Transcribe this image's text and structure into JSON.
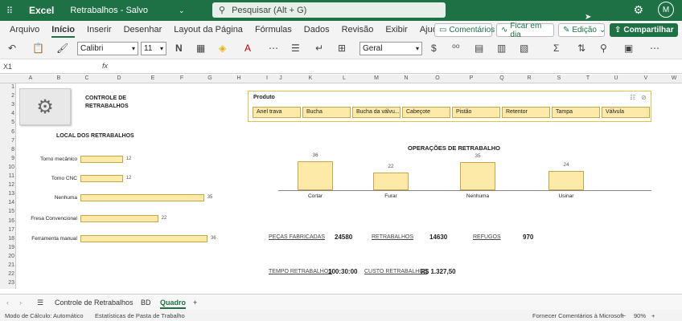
{
  "titlebar": {
    "app": "Excel",
    "doc": "Retrabalhos - Salvo",
    "search_placeholder": "Pesquisar (Alt + G)",
    "avatar": "M"
  },
  "menu": {
    "tabs": [
      "Arquivo",
      "Início",
      "Inserir",
      "Desenhar",
      "Layout da Página",
      "Fórmulas",
      "Dados",
      "Revisão",
      "Exibir",
      "Ajuda"
    ],
    "active": "Início",
    "comments": "Comentários",
    "catchup": "Ficar em dia",
    "editing": "Edição",
    "share": "Compartilhar"
  },
  "ribbon": {
    "font": "Calibri",
    "size": "11",
    "format": "Geral"
  },
  "formula": {
    "cell": "X1",
    "fx": "fx"
  },
  "columns": [
    "A",
    "B",
    "C",
    "D",
    "E",
    "F",
    "G",
    "H",
    "I",
    "J",
    "K",
    "L",
    "M",
    "N",
    "O",
    "P",
    "Q",
    "R",
    "S",
    "T",
    "U",
    "V",
    "W"
  ],
  "rows": [
    "1",
    "2",
    "3",
    "4",
    "5",
    "6",
    "7",
    "8",
    "9",
    "10",
    "11",
    "12",
    "13",
    "14",
    "15",
    "16",
    "17",
    "18",
    "19",
    "20",
    "21",
    "22",
    "23"
  ],
  "dashboard": {
    "control_title_1": "CONTROLE DE",
    "control_title_2": "RETRABALHOS",
    "local_title": "LOCAL DOS RETRABALHOS",
    "local_items": [
      {
        "label": "Torno mecânico",
        "value": 12
      },
      {
        "label": "Torno CNC",
        "value": 12
      },
      {
        "label": "Nenhuma",
        "value": 35
      },
      {
        "label": "Fresa Convencional",
        "value": 22
      },
      {
        "label": "Ferramenta manual",
        "value": 36
      }
    ],
    "slicer_title": "Produto",
    "slicer_items": [
      "Anel trava",
      "Bucha",
      "Bucha da válvu...",
      "Cabeçote",
      "Pistão",
      "Retentor",
      "Tampa",
      "Válvula"
    ],
    "ops_title": "OPERAÇÕES  DE RETRABALHO",
    "ops_items": [
      {
        "label": "Cortar",
        "value": 36
      },
      {
        "label": "Furar",
        "value": 22
      },
      {
        "label": "Nenhuma",
        "value": 35
      },
      {
        "label": "Usinar",
        "value": 24
      }
    ],
    "kpi": {
      "pecas_label": "PEÇAS FABRICADAS",
      "pecas_value": "24580",
      "retrab_label": "RETRABALHOS",
      "retrab_value": "14630",
      "refugos_label": "REFUGOS",
      "refugos_value": "970",
      "tempo_label": "TEMPO RETRABALHOS",
      "tempo_value": "100:30:00",
      "custo_label": "CUSTO RETRABALHOS",
      "custo_value": "R$ 1.327,50"
    }
  },
  "sheets": [
    "Controle de Retrabalhos",
    "BD",
    "Quadro"
  ],
  "active_sheet": "Quadro",
  "status": {
    "calc": "Modo de Cálculo: Automático",
    "stats": "Estatísticas de Pasta de Trabalho",
    "feedback": "Fornecer Comentários à Microsoft",
    "zoom": "90%"
  },
  "colors": {
    "brand": "#1e7145",
    "bar_fill": "#fde9a8",
    "bar_stroke": "#c9a64a"
  }
}
